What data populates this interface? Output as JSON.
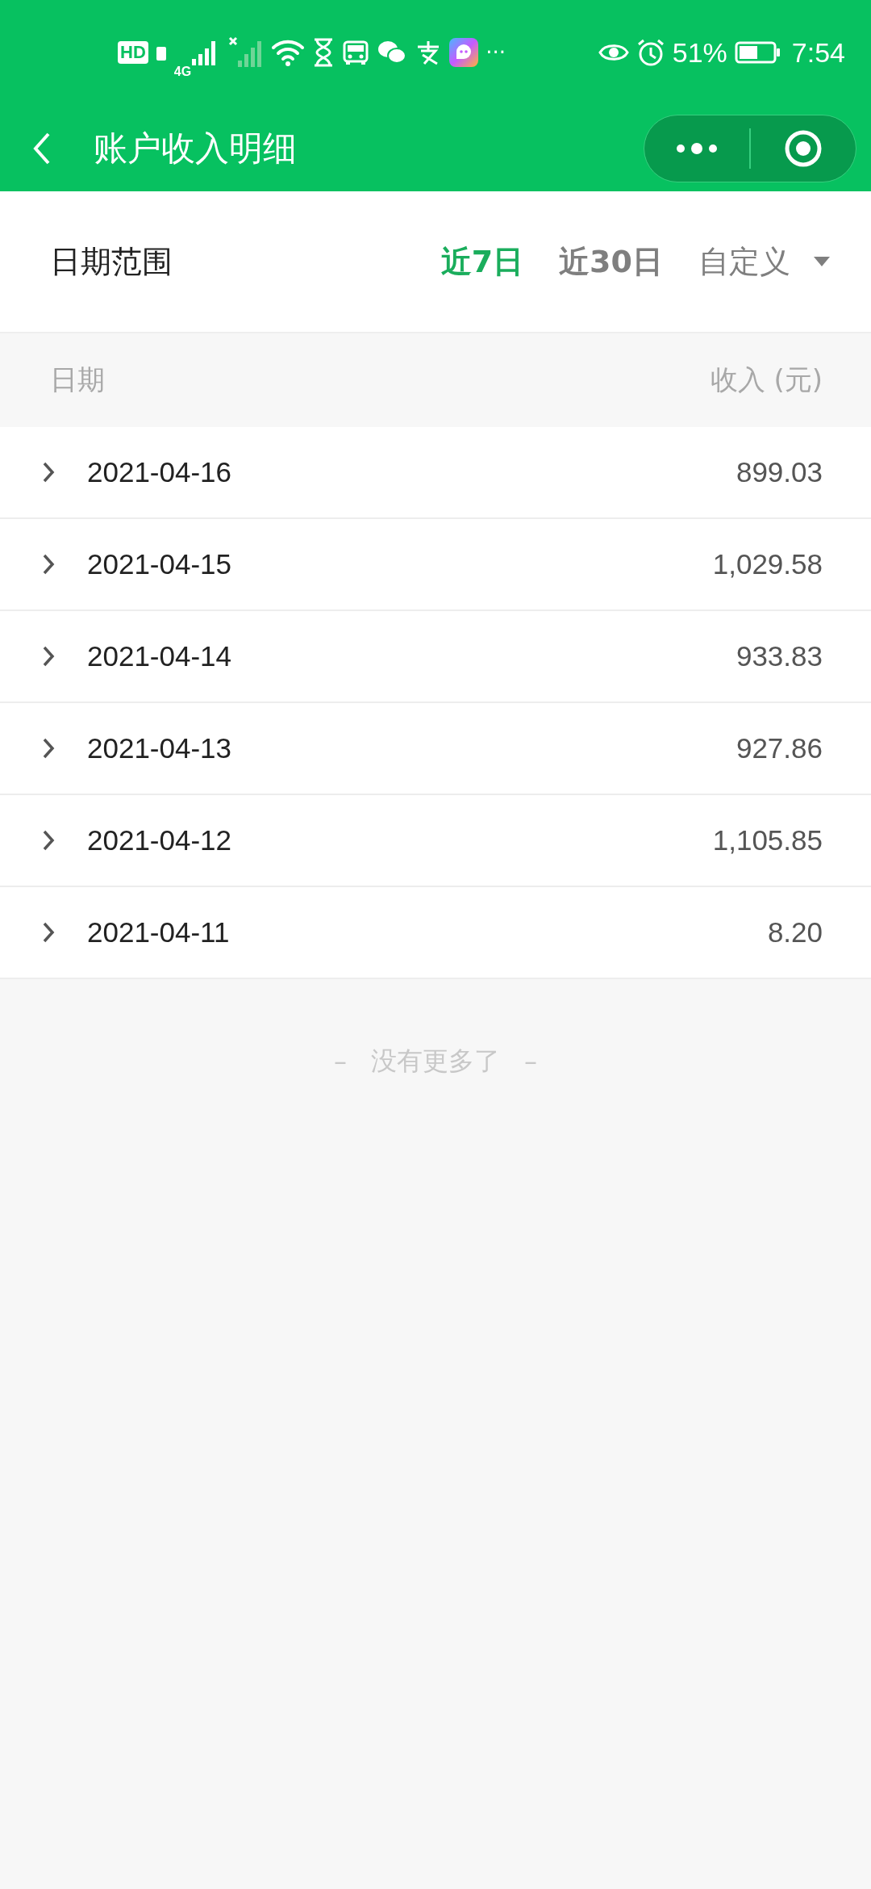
{
  "status_bar": {
    "badges": [
      "HD",
      "4G"
    ],
    "more": "···",
    "battery": "51%",
    "time": "7:54"
  },
  "nav": {
    "title": "账户收入明细"
  },
  "filter": {
    "label": "日期范围",
    "options": [
      {
        "label": "近7日",
        "selected": true,
        "kind": "tab"
      },
      {
        "label": "近30日",
        "selected": false,
        "kind": "tab"
      },
      {
        "label": "自定义",
        "selected": false,
        "kind": "dropdown"
      }
    ]
  },
  "table": {
    "columns": [
      "日期",
      "收入 (元)"
    ],
    "rows": [
      {
        "date": "2021-04-16",
        "amount": "899.03",
        "expanded": false
      },
      {
        "date": "2021-04-15",
        "amount": "1,029.58",
        "expanded": false
      },
      {
        "date": "2021-04-14",
        "amount": "933.83",
        "expanded": false
      },
      {
        "date": "2021-04-13",
        "amount": "927.86",
        "expanded": false
      },
      {
        "date": "2021-04-12",
        "amount": "1,105.85",
        "expanded": false
      },
      {
        "date": "2021-04-11",
        "amount": "8.20",
        "expanded": false
      }
    ]
  },
  "footer": {
    "dash_left": "–",
    "text": "没有更多了",
    "dash_right": "–"
  }
}
